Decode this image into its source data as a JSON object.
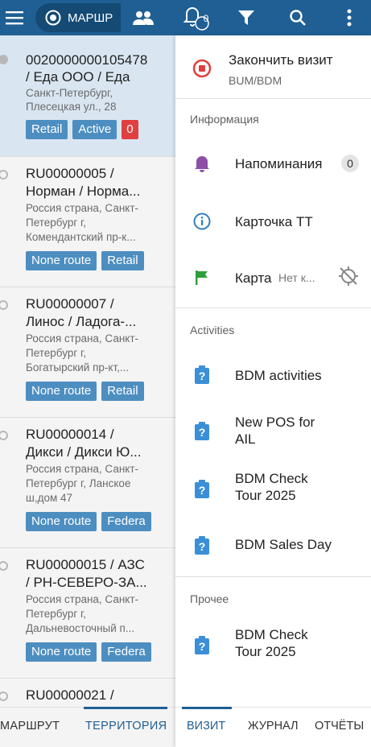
{
  "topbar": {
    "route_label": "МАРШР",
    "notifications_count": "0"
  },
  "visits": [
    {
      "title1": "0020000000105478",
      "title2": "/ Еда ООО / Еда",
      "addr": [
        "Санкт-Петербург,",
        "Плесецкая ул., 28"
      ],
      "tags": [
        "Retail",
        "Active",
        "0"
      ],
      "selected": true
    },
    {
      "title1": "RU00000005 /",
      "title2": "Норман / Норма...",
      "addr": [
        "Россия страна, Санкт-",
        "Петербург г,",
        "Комендантский пр-к..."
      ],
      "tags": [
        "None route",
        "Retail"
      ]
    },
    {
      "title1": "RU00000007 /",
      "title2": "Линос / Ладога-...",
      "addr": [
        "Россия страна, Санкт-",
        "Петербург г,",
        "Богатырский пр-кт,..."
      ],
      "tags": [
        "None route",
        "Retail"
      ]
    },
    {
      "title1": "RU00000014 /",
      "title2": "Дикси / Дикси Ю...",
      "addr": [
        "Россия страна, Санкт-",
        "Петербург г, Ланское",
        "ш,дом 47"
      ],
      "tags": [
        "None route",
        "Federa"
      ]
    },
    {
      "title1": "RU00000015 / АЗС",
      "title2": "/ РН-СЕВЕРО-ЗА...",
      "addr": [
        "Россия страна, Санкт-",
        "Петербург г,",
        "Дальневосточный п..."
      ],
      "tags": [
        "None route",
        "Federa"
      ]
    },
    {
      "title1": "RU00000021 /",
      "title2": "",
      "addr": [],
      "tags": []
    }
  ],
  "left_tabs": {
    "route": "МАРШРУТ",
    "territory": "ТЕРРИТОРИЯ"
  },
  "panel": {
    "end_visit": {
      "label": "Закончить визит",
      "sub": "BUM/BDM"
    },
    "info_title": "Информация",
    "reminders": {
      "label": "Напоминания",
      "count": "0"
    },
    "card_tt": "Карточка ТТ",
    "map": {
      "label": "Карта",
      "status": "Нет к..."
    },
    "activities_title": "Activities",
    "activities": [
      {
        "l1": "BDM activities",
        "l2": ""
      },
      {
        "l1": "New POS for",
        "l2": "AIL"
      },
      {
        "l1": "BDM Check",
        "l2": "Tour 2025"
      },
      {
        "l1": "BDM Sales Day",
        "l2": ""
      }
    ],
    "other_title": "Прочее",
    "other": [
      {
        "l1": "BDM Check",
        "l2": "Tour 2025"
      }
    ]
  },
  "right_tabs": {
    "visit": "ВИЗИТ",
    "journal": "ЖУРНАЛ",
    "reports": "ОТЧЁТЫ"
  },
  "colors": {
    "primary": "#1f5f93",
    "tag": "#4d8ec1",
    "danger": "#e04040",
    "flag": "#2e9e3c",
    "bell": "#8c4fa5",
    "info": "#2f7fc1"
  }
}
